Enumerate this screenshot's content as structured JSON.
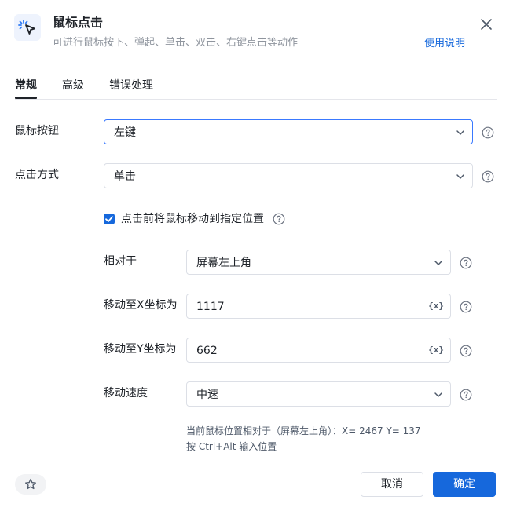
{
  "header": {
    "title": "鼠标点击",
    "subtitle": "可进行鼠标按下、弹起、单击、双击、右键点击等动作",
    "help_link": "使用说明",
    "icon": "mouse-click-icon"
  },
  "tabs": [
    {
      "label": "常规",
      "active": true
    },
    {
      "label": "高级",
      "active": false
    },
    {
      "label": "错误处理",
      "active": false
    }
  ],
  "form": {
    "mouse_button": {
      "label": "鼠标按钮",
      "value": "左键"
    },
    "click_mode": {
      "label": "点击方式",
      "value": "单击"
    },
    "move_before_click": {
      "label": "点击前将鼠标移动到指定位置",
      "checked": true
    },
    "relative_to": {
      "label": "相对于",
      "value": "屏幕左上角"
    },
    "move_x": {
      "label": "移动至X坐标为",
      "value": "1117",
      "var_icon": "{x}"
    },
    "move_y": {
      "label": "移动至Y坐标为",
      "value": "662",
      "var_icon": "{x}"
    },
    "move_speed": {
      "label": "移动速度",
      "value": "中速"
    }
  },
  "info": {
    "line1": "当前鼠标位置相对于（屏幕左上角）：X= 2467   Y= 137",
    "line2": "按 Ctrl+Alt 输入位置"
  },
  "footer": {
    "cancel_label": "取消",
    "ok_label": "确定"
  },
  "colors": {
    "accent": "#1668dc",
    "focus_border": "#3a79ff",
    "muted_text": "#8f959e"
  }
}
